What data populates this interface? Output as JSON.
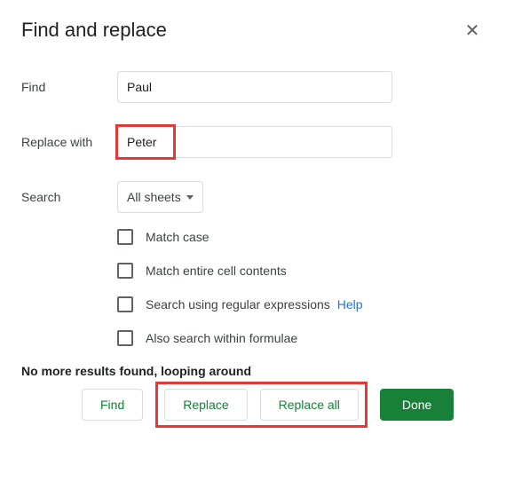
{
  "dialog": {
    "title": "Find and replace",
    "close": "✕"
  },
  "fields": {
    "find_label": "Find",
    "find_value": "Paul",
    "replace_label": "Replace with",
    "replace_value": "Peter",
    "search_label": "Search",
    "search_value": "All sheets"
  },
  "options": {
    "match_case": "Match case",
    "match_entire": "Match entire cell contents",
    "regex": "Search using regular expressions",
    "regex_help": "Help",
    "formulae": "Also search within formulae"
  },
  "status": "No more results found, looping around",
  "buttons": {
    "find": "Find",
    "replace": "Replace",
    "replace_all": "Replace all",
    "done": "Done"
  }
}
